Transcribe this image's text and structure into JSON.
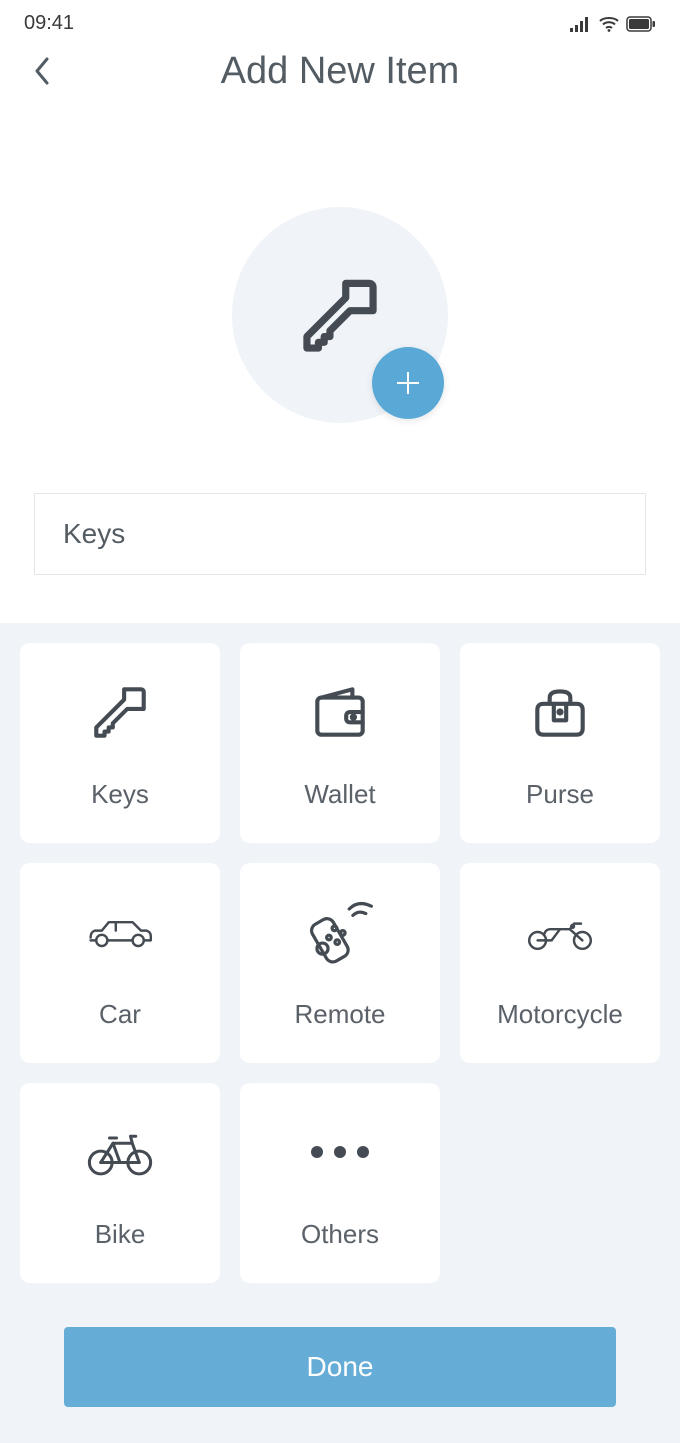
{
  "status": {
    "time": "09:41"
  },
  "header": {
    "title": "Add New Item"
  },
  "input": {
    "value": "Keys"
  },
  "tiles": [
    {
      "id": "keys",
      "label": "Keys"
    },
    {
      "id": "wallet",
      "label": "Wallet"
    },
    {
      "id": "purse",
      "label": "Purse"
    },
    {
      "id": "car",
      "label": "Car"
    },
    {
      "id": "remote",
      "label": "Remote"
    },
    {
      "id": "motorcycle",
      "label": "Motorcycle"
    },
    {
      "id": "bike",
      "label": "Bike"
    },
    {
      "id": "others",
      "label": "Others"
    }
  ],
  "buttons": {
    "done": "Done"
  },
  "colors": {
    "accent": "#65add7",
    "plusBadge": "#5aa8d6",
    "panel": "#f0f4f8",
    "iconStroke": "#444b52",
    "text": "#535c63"
  }
}
